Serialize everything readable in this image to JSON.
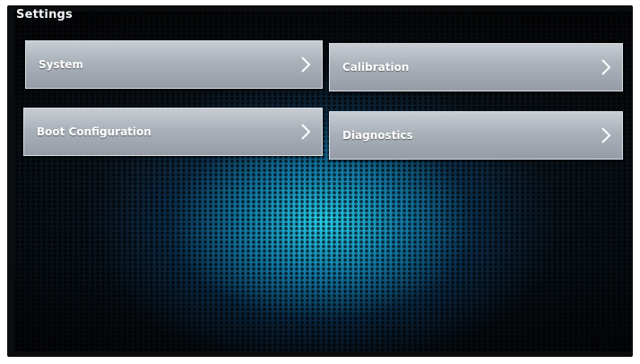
{
  "header": {
    "title": "Settings"
  },
  "menu": {
    "items": [
      {
        "label": "System",
        "icon": "chevron-right-icon"
      },
      {
        "label": "Calibration",
        "icon": "chevron-right-icon"
      },
      {
        "label": "Boot Configuration",
        "icon": "chevron-right-icon"
      },
      {
        "label": "Diagnostics",
        "icon": "chevron-right-icon"
      }
    ]
  },
  "colors": {
    "tile_top": "#c7cdd3",
    "tile_bottom": "#959ca6",
    "glow": "#28d2f0",
    "background": "#0a0d11",
    "text": "#ffffff"
  }
}
